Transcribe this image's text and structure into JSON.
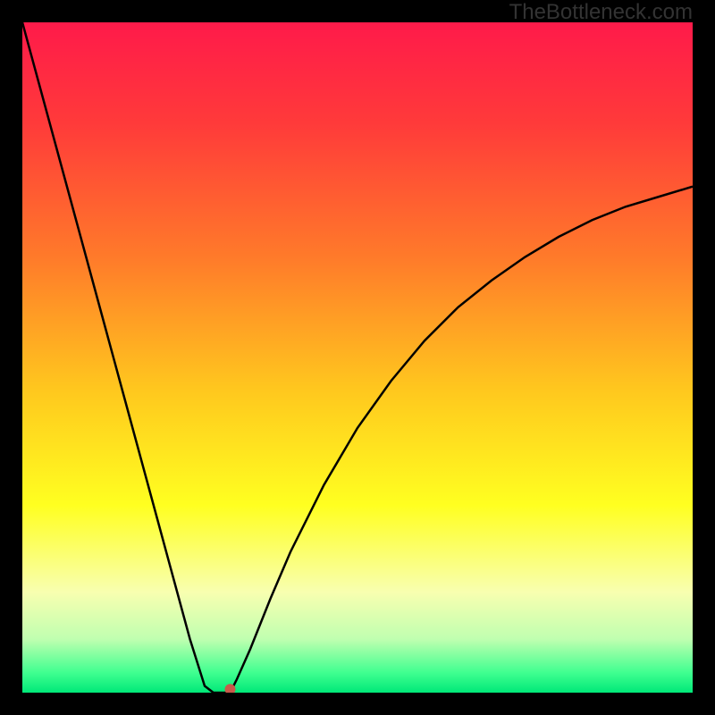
{
  "watermark": "TheBottleneck.com",
  "colors": {
    "black": "#000000",
    "curve": "#000000",
    "marker": "#c85a4a",
    "gradient_stops": [
      {
        "offset": 0.0,
        "color": "#ff1a4a"
      },
      {
        "offset": 0.15,
        "color": "#ff3a3a"
      },
      {
        "offset": 0.35,
        "color": "#ff7a2a"
      },
      {
        "offset": 0.55,
        "color": "#ffc81e"
      },
      {
        "offset": 0.72,
        "color": "#ffff20"
      },
      {
        "offset": 0.85,
        "color": "#f8ffb0"
      },
      {
        "offset": 0.92,
        "color": "#c0ffb0"
      },
      {
        "offset": 0.97,
        "color": "#40ff90"
      },
      {
        "offset": 1.0,
        "color": "#00e878"
      }
    ]
  },
  "chart_data": {
    "type": "line",
    "title": "",
    "xlabel": "",
    "ylabel": "",
    "xlim": [
      0,
      1
    ],
    "ylim": [
      0,
      1
    ],
    "series": [
      {
        "name": "curve",
        "x": [
          0.0,
          0.025,
          0.05,
          0.075,
          0.1,
          0.125,
          0.15,
          0.175,
          0.2,
          0.225,
          0.25,
          0.272,
          0.285,
          0.295,
          0.305,
          0.31,
          0.32,
          0.34,
          0.37,
          0.4,
          0.45,
          0.5,
          0.55,
          0.6,
          0.65,
          0.7,
          0.75,
          0.8,
          0.85,
          0.9,
          0.95,
          1.0
        ],
        "y": [
          1.0,
          0.908,
          0.816,
          0.724,
          0.632,
          0.54,
          0.448,
          0.356,
          0.264,
          0.172,
          0.08,
          0.01,
          0.0,
          0.0,
          0.0,
          0.0,
          0.02,
          0.065,
          0.14,
          0.21,
          0.31,
          0.395,
          0.465,
          0.525,
          0.575,
          0.615,
          0.65,
          0.68,
          0.705,
          0.725,
          0.74,
          0.755
        ]
      }
    ],
    "annotations": {
      "flat_bottom_x_range": [
        0.275,
        0.31
      ],
      "marker_point": {
        "x": 0.31,
        "y": 0.005
      }
    }
  }
}
